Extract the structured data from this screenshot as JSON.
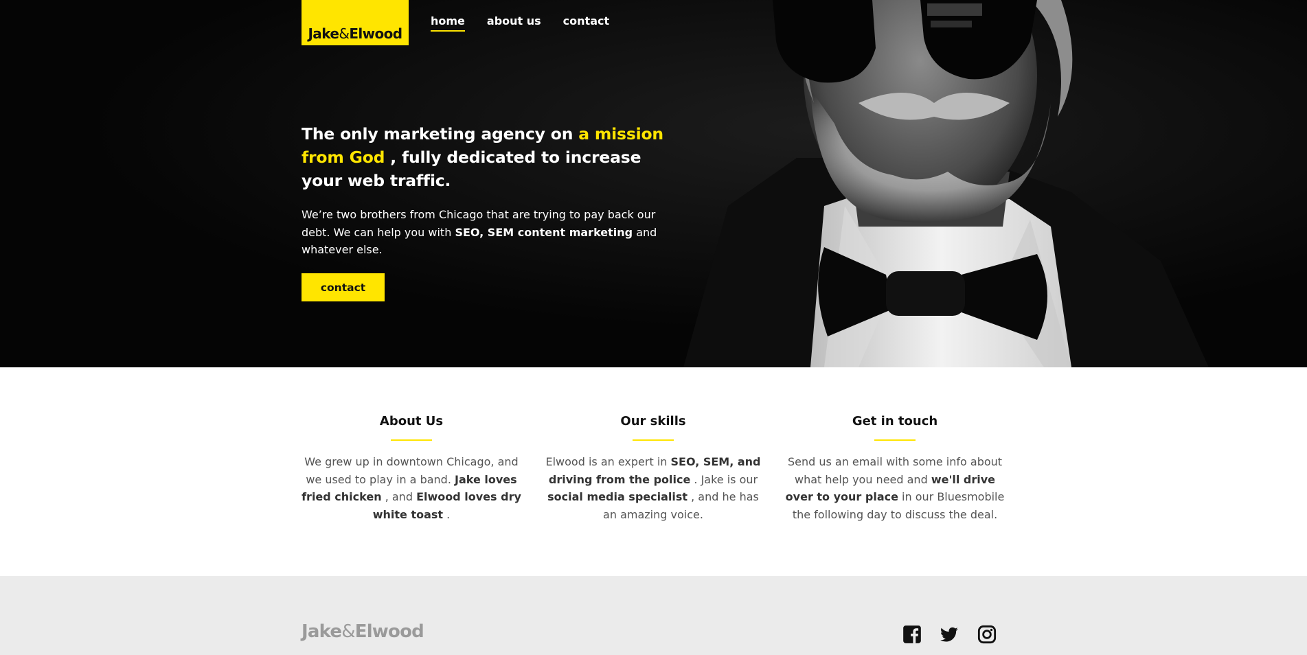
{
  "brand": {
    "name_part1": "Jake",
    "ampersand": "&",
    "name_part2": "Elwood",
    "accent_color": "#ffe500"
  },
  "nav": {
    "items": [
      {
        "label": "home",
        "active": true
      },
      {
        "label": "about us",
        "active": false
      },
      {
        "label": "contact",
        "active": false
      }
    ]
  },
  "hero": {
    "headline_start": "The only marketing agency on ",
    "headline_highlight": "a mission from God",
    "headline_end": " , fully dedicated to increase your web traffic.",
    "lead_start": "We’re two brothers from Chicago that are trying to pay back our debt. We can help you with ",
    "lead_bold": "SEO, SEM content marketing",
    "lead_end": " and whatever else.",
    "cta_label": "contact"
  },
  "features": [
    {
      "title": "About Us",
      "text": [
        {
          "t": "We grew up in downtown Chicago, and we used to play in a band. ",
          "b": false
        },
        {
          "t": "Jake loves fried chicken",
          "b": true
        },
        {
          "t": " , and ",
          "b": false
        },
        {
          "t": "Elwood loves dry white toast",
          "b": true
        },
        {
          "t": " .",
          "b": false
        }
      ]
    },
    {
      "title": "Our skills",
      "text": [
        {
          "t": "Elwood is an expert in ",
          "b": false
        },
        {
          "t": "SEO, SEM, and driving from the police",
          "b": true
        },
        {
          "t": " . Jake is our ",
          "b": false
        },
        {
          "t": "social media specialist",
          "b": true
        },
        {
          "t": " , and he has an amazing voice.",
          "b": false
        }
      ]
    },
    {
      "title": "Get in touch",
      "text": [
        {
          "t": "Send us an email with some info about what help you need and ",
          "b": false
        },
        {
          "t": "we'll drive over to your place",
          "b": true
        },
        {
          "t": " in our Bluesmobile the following day to discuss the deal.",
          "b": false
        }
      ]
    }
  ],
  "footer": {
    "social_icons": [
      "facebook-icon",
      "twitter-icon",
      "instagram-icon"
    ]
  }
}
